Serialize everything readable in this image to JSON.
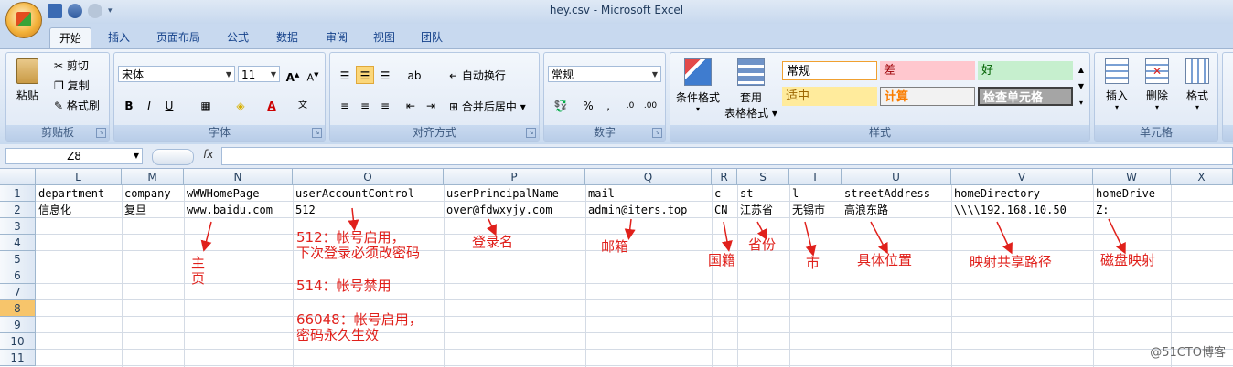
{
  "window": {
    "title": "hey.csv - Microsoft Excel"
  },
  "tabs": [
    "开始",
    "插入",
    "页面布局",
    "公式",
    "数据",
    "审阅",
    "视图",
    "团队"
  ],
  "active_tab": "开始",
  "ribbon": {
    "clipboard": {
      "paste": "粘贴",
      "cut": "剪切",
      "copy": "复制",
      "format_painter": "格式刷",
      "label": "剪贴板"
    },
    "font": {
      "name": "宋体",
      "size": "11",
      "bold": "B",
      "italic": "I",
      "underline": "U",
      "label": "字体"
    },
    "alignment": {
      "wrap_text": "自动换行",
      "merge_center": "合并后居中",
      "label": "对齐方式"
    },
    "number": {
      "format": "常规",
      "label": "数字"
    },
    "styles": {
      "conditional_format": "条件格式",
      "table_format_line1": "套用",
      "table_format_line2": "表格格式",
      "cells": [
        "常规",
        "差",
        "好",
        "适中",
        "计算",
        "检查单元格"
      ],
      "label": "样式"
    },
    "cells": {
      "insert": "插入",
      "delete": "删除",
      "format": "格式",
      "label": "单元格"
    }
  },
  "formula_bar": {
    "name_box": "Z8",
    "fx": "fx",
    "content": ""
  },
  "columns": [
    "L",
    "M",
    "N",
    "O",
    "P",
    "Q",
    "R",
    "S",
    "T",
    "U",
    "V",
    "W",
    "X"
  ],
  "rows": [
    "1",
    "2",
    "3",
    "4",
    "5",
    "6",
    "7",
    "8",
    "9",
    "10",
    "11"
  ],
  "selected_row": "8",
  "row1": [
    "department",
    "company",
    "wWWHomePage",
    "userAccountControl",
    "userPrincipalName",
    "mail",
    "c",
    "st",
    "l",
    "streetAddress",
    "homeDirectory",
    "homeDrive",
    ""
  ],
  "row2": [
    "信息化",
    "复旦",
    "www.baidu.com",
    "512",
    "over@fdwxyjy.com",
    "admin@iters.top",
    "CN",
    "江苏省",
    "无锡市",
    "高浪东路",
    "\\\\\\\\192.168.10.50",
    "Z:",
    ""
  ],
  "annotations": {
    "homepage_1": "主",
    "homepage_2": "页",
    "uac_512_1": "512：帐号启用，",
    "uac_512_2": "下次登录必须改密码",
    "uac_514": "514：帐号禁用",
    "uac_66048_1": "66048：帐号启用，",
    "uac_66048_2": "密码永久生效",
    "upn": "登录名",
    "mail": "邮箱",
    "country": "国籍",
    "province": "省份",
    "city": "市",
    "address": "具体位置",
    "home_dir": "映射共享路径",
    "home_drive": "磁盘映射"
  },
  "watermark": "@51CTO博客",
  "colors": {
    "annotation": "#e0201b",
    "selected_row": "#f7c56b"
  }
}
